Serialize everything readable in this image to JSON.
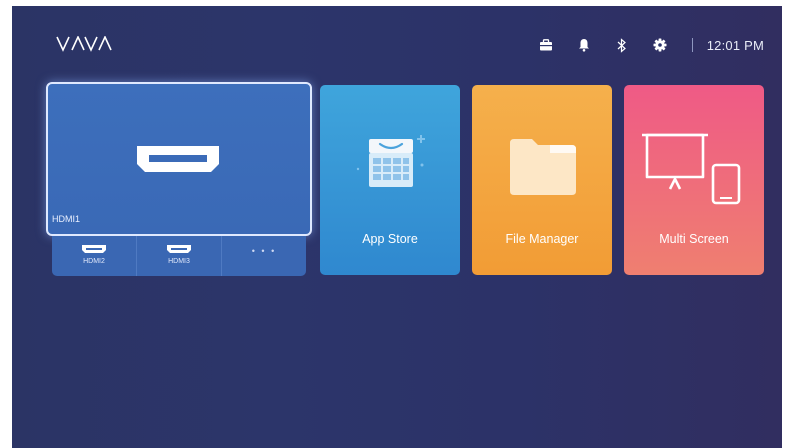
{
  "brand": {
    "logo_text": "VAVA"
  },
  "status_bar": {
    "icons": [
      "suitcase-icon",
      "bell-icon",
      "bluetooth-icon",
      "gear-icon"
    ],
    "time": "12:01 PM"
  },
  "inputs": {
    "main": {
      "label": "HDMI1",
      "icon": "hdmi-port-icon"
    },
    "sub": [
      {
        "label": "HDMI2",
        "icon": "hdmi-port-icon"
      },
      {
        "label": "HDMI3",
        "icon": "hdmi-port-icon"
      },
      {
        "label": "",
        "icon": "more-dots-icon"
      }
    ],
    "more_glyph": "• • •"
  },
  "apps": [
    {
      "label": "App Store",
      "icon": "shopping-bag-icon",
      "color": "#3a98d6"
    },
    {
      "label": "File Manager",
      "icon": "folder-icon",
      "color": "#f3a640"
    },
    {
      "label": "Multi Screen",
      "icon": "screen-share-icon",
      "color": "#ef6a7e"
    }
  ],
  "colors": {
    "background": "#2c346a",
    "hdmi_tile": "#3b6bb8",
    "focus_border": "#dfe9ff"
  }
}
